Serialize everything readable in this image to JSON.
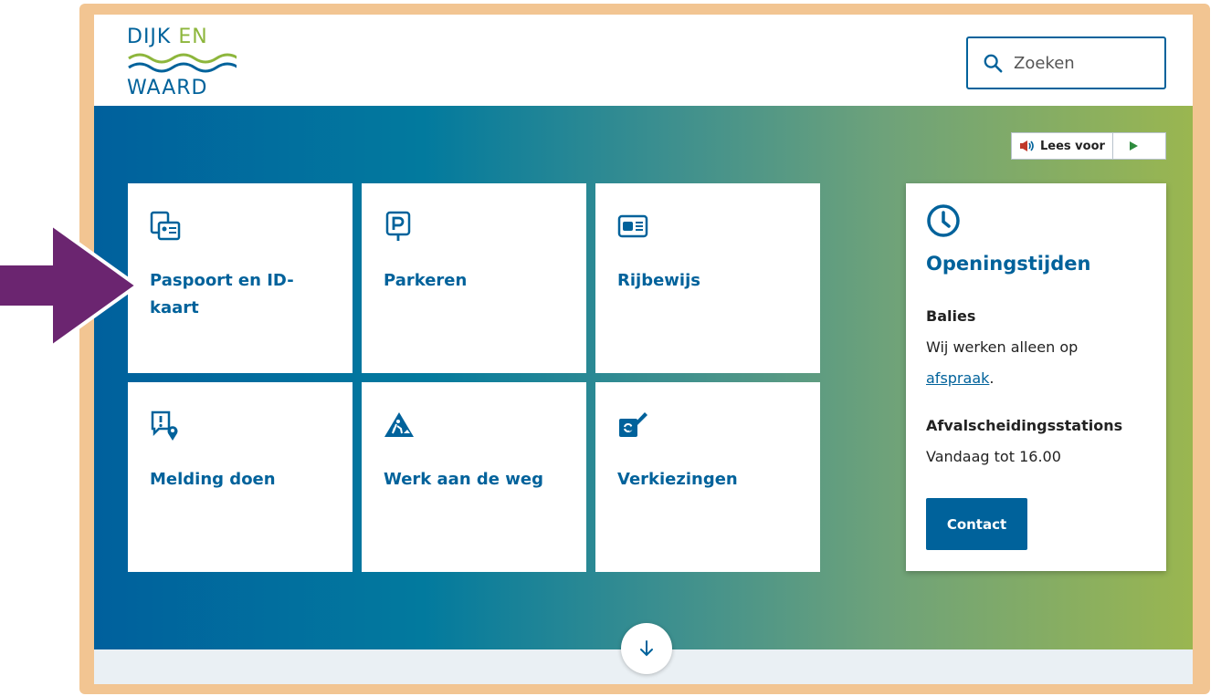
{
  "logo": {
    "line1_a": "DIJK ",
    "line1_b": "EN",
    "line2": "WAARD",
    "colors": {
      "blue": "#00629b",
      "green": "#8db63c"
    }
  },
  "search": {
    "placeholder": "Zoeken",
    "icon": "search-icon"
  },
  "read_aloud": {
    "label": "Lees voor",
    "speaker_icon": "speaker-icon",
    "play_icon": "play-icon"
  },
  "tiles": [
    {
      "label": "Paspoort en ID-kaart",
      "icon": "passport-id-icon"
    },
    {
      "label": "Parkeren",
      "icon": "parking-icon"
    },
    {
      "label": "Rijbewijs",
      "icon": "drivers-license-icon"
    },
    {
      "label": "Melding doen",
      "icon": "report-location-icon"
    },
    {
      "label": "Werk aan de weg",
      "icon": "roadwork-icon"
    },
    {
      "label": "Verkiezingen",
      "icon": "ballot-icon"
    }
  ],
  "opening_hours": {
    "title": "Openingstijden",
    "icon": "clock-icon",
    "counters_heading": "Balies",
    "counters_text": "Wij werken alleen op ",
    "counters_link": "afspraak",
    "counters_suffix": ".",
    "waste_heading": "Afvalscheidingsstations",
    "waste_text": "Vandaag tot 16.00",
    "contact_label": "Contact"
  },
  "scroll_down": {
    "icon": "arrow-down-icon"
  },
  "annotation": {
    "icon": "pointer-arrow-icon",
    "color": "#6b2570"
  },
  "colors": {
    "accent": "#00629b",
    "frame": "#f2c592"
  }
}
